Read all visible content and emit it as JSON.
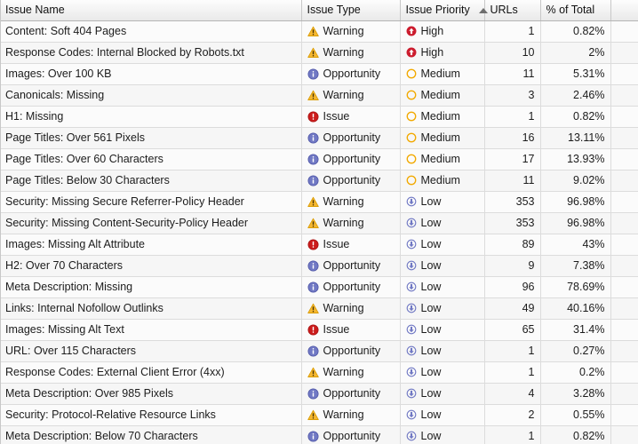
{
  "table": {
    "columns": [
      {
        "key": "issue_name",
        "label": "Issue Name",
        "align": "left",
        "sorted": false
      },
      {
        "key": "issue_type",
        "label": "Issue Type",
        "align": "left",
        "sorted": false
      },
      {
        "key": "issue_priority",
        "label": "Issue Priority",
        "align": "left",
        "sorted": true,
        "sort_direction": "ascending",
        "sort_indicator": "caret-up-icon"
      },
      {
        "key": "urls",
        "label": "URLs",
        "align": "right",
        "sorted": false
      },
      {
        "key": "percent_of_total",
        "label": "% of Total",
        "align": "right",
        "sorted": false
      },
      {
        "key": "clipped",
        "label": "",
        "align": "left",
        "sorted": false
      }
    ],
    "icons": {
      "warning": {
        "name": "warning-triangle-icon",
        "color": "#f5b731",
        "stroke": "#d99b00"
      },
      "opportunity": {
        "name": "info-circle-icon",
        "color": "#7179c4",
        "stroke": "#5158a8"
      },
      "issue": {
        "name": "error-exclamation-circle-icon",
        "color": "#cc1c1c",
        "stroke": "#a81414"
      },
      "high": {
        "name": "priority-high-arrow-up-icon",
        "color": "#cc1c2e",
        "stroke": "#cc1c2e"
      },
      "medium": {
        "name": "priority-medium-circle-icon",
        "color": "#f2a900",
        "stroke": "#f2a900"
      },
      "low": {
        "name": "priority-low-arrow-down-icon",
        "color": "#7179c4",
        "stroke": "#7179c4"
      }
    },
    "rows": [
      {
        "issue_name": "Content: Soft 404 Pages",
        "issue_type": "Warning",
        "type_icon": "warning",
        "issue_priority": "High",
        "priority_icon": "high",
        "urls": "1",
        "percent_of_total": "0.82%"
      },
      {
        "issue_name": "Response Codes: Internal Blocked by Robots.txt",
        "issue_type": "Warning",
        "type_icon": "warning",
        "issue_priority": "High",
        "priority_icon": "high",
        "urls": "10",
        "percent_of_total": "2%"
      },
      {
        "issue_name": "Images: Over 100 KB",
        "issue_type": "Opportunity",
        "type_icon": "opportunity",
        "issue_priority": "Medium",
        "priority_icon": "medium",
        "urls": "11",
        "percent_of_total": "5.31%"
      },
      {
        "issue_name": "Canonicals: Missing",
        "issue_type": "Warning",
        "type_icon": "warning",
        "issue_priority": "Medium",
        "priority_icon": "medium",
        "urls": "3",
        "percent_of_total": "2.46%"
      },
      {
        "issue_name": "H1: Missing",
        "issue_type": "Issue",
        "type_icon": "issue",
        "issue_priority": "Medium",
        "priority_icon": "medium",
        "urls": "1",
        "percent_of_total": "0.82%"
      },
      {
        "issue_name": "Page Titles: Over 561 Pixels",
        "issue_type": "Opportunity",
        "type_icon": "opportunity",
        "issue_priority": "Medium",
        "priority_icon": "medium",
        "urls": "16",
        "percent_of_total": "13.11%"
      },
      {
        "issue_name": "Page Titles: Over 60 Characters",
        "issue_type": "Opportunity",
        "type_icon": "opportunity",
        "issue_priority": "Medium",
        "priority_icon": "medium",
        "urls": "17",
        "percent_of_total": "13.93%"
      },
      {
        "issue_name": "Page Titles: Below 30 Characters",
        "issue_type": "Opportunity",
        "type_icon": "opportunity",
        "issue_priority": "Medium",
        "priority_icon": "medium",
        "urls": "11",
        "percent_of_total": "9.02%"
      },
      {
        "issue_name": "Security: Missing Secure Referrer-Policy Header",
        "issue_type": "Warning",
        "type_icon": "warning",
        "issue_priority": "Low",
        "priority_icon": "low",
        "urls": "353",
        "percent_of_total": "96.98%"
      },
      {
        "issue_name": "Security: Missing Content-Security-Policy Header",
        "issue_type": "Warning",
        "type_icon": "warning",
        "issue_priority": "Low",
        "priority_icon": "low",
        "urls": "353",
        "percent_of_total": "96.98%"
      },
      {
        "issue_name": "Images: Missing Alt Attribute",
        "issue_type": "Issue",
        "type_icon": "issue",
        "issue_priority": "Low",
        "priority_icon": "low",
        "urls": "89",
        "percent_of_total": "43%"
      },
      {
        "issue_name": "H2: Over 70 Characters",
        "issue_type": "Opportunity",
        "type_icon": "opportunity",
        "issue_priority": "Low",
        "priority_icon": "low",
        "urls": "9",
        "percent_of_total": "7.38%"
      },
      {
        "issue_name": "Meta Description: Missing",
        "issue_type": "Opportunity",
        "type_icon": "opportunity",
        "issue_priority": "Low",
        "priority_icon": "low",
        "urls": "96",
        "percent_of_total": "78.69%"
      },
      {
        "issue_name": "Links: Internal Nofollow Outlinks",
        "issue_type": "Warning",
        "type_icon": "warning",
        "issue_priority": "Low",
        "priority_icon": "low",
        "urls": "49",
        "percent_of_total": "40.16%"
      },
      {
        "issue_name": "Images: Missing Alt Text",
        "issue_type": "Issue",
        "type_icon": "issue",
        "issue_priority": "Low",
        "priority_icon": "low",
        "urls": "65",
        "percent_of_total": "31.4%"
      },
      {
        "issue_name": "URL: Over 115 Characters",
        "issue_type": "Opportunity",
        "type_icon": "opportunity",
        "issue_priority": "Low",
        "priority_icon": "low",
        "urls": "1",
        "percent_of_total": "0.27%"
      },
      {
        "issue_name": "Response Codes: External Client Error (4xx)",
        "issue_type": "Warning",
        "type_icon": "warning",
        "issue_priority": "Low",
        "priority_icon": "low",
        "urls": "1",
        "percent_of_total": "0.2%"
      },
      {
        "issue_name": "Meta Description: Over 985 Pixels",
        "issue_type": "Opportunity",
        "type_icon": "opportunity",
        "issue_priority": "Low",
        "priority_icon": "low",
        "urls": "4",
        "percent_of_total": "3.28%"
      },
      {
        "issue_name": "Security: Protocol-Relative Resource Links",
        "issue_type": "Warning",
        "type_icon": "warning",
        "issue_priority": "Low",
        "priority_icon": "low",
        "urls": "2",
        "percent_of_total": "0.55%"
      },
      {
        "issue_name": "Meta Description: Below 70 Characters",
        "issue_type": "Opportunity",
        "type_icon": "opportunity",
        "issue_priority": "Low",
        "priority_icon": "low",
        "urls": "1",
        "percent_of_total": "0.82%"
      }
    ]
  }
}
